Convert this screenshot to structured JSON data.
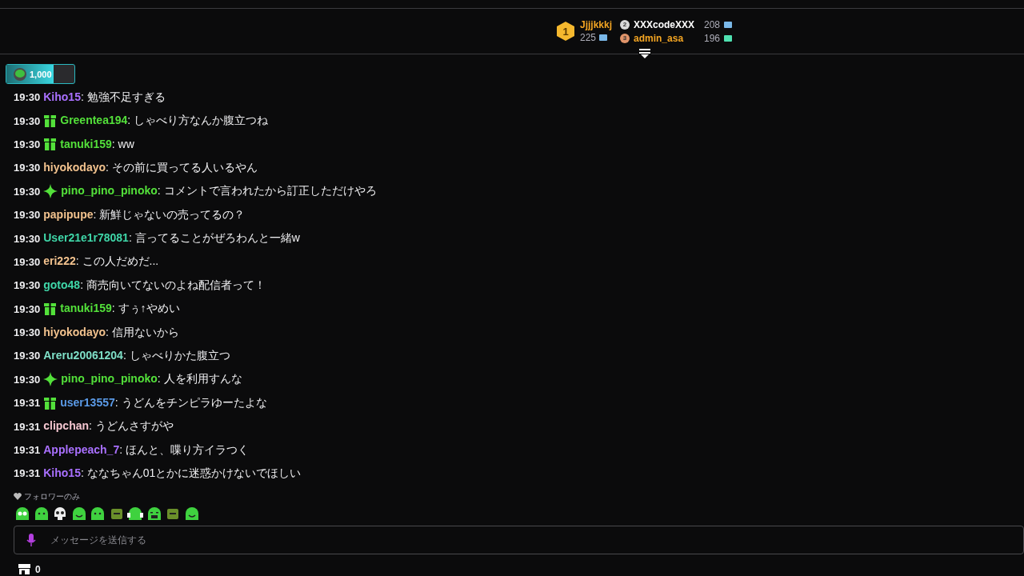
{
  "leaderboard": [
    {
      "rank": "1",
      "name": "Jjjjkkkj",
      "points": "225",
      "color": "#f5a623"
    },
    {
      "rank": "2",
      "name": "XXXcodeXXX",
      "points": "208",
      "color": "#ffffff"
    },
    {
      "rank": "3",
      "name": "admin_asa",
      "points": "196",
      "color": "#f5a623"
    }
  ],
  "goal": {
    "amount": "1,000",
    "level": 0.69
  },
  "messages": [
    {
      "time": "19:30",
      "kind": "plain",
      "user": "Kiho15",
      "color": "#a970ff",
      "text": ": 勉強不足すぎる"
    },
    {
      "time": "19:30",
      "kind": "gift",
      "user": "Greentea194",
      "color": "#53e03a",
      "text": ": しゃべり方なんか腹立つね"
    },
    {
      "time": "19:30",
      "kind": "gift",
      "user": "tanuki159",
      "color": "#53e03a",
      "text": ": ww"
    },
    {
      "time": "19:30",
      "kind": "plain",
      "user": "hiyokodayo",
      "color": "#f2c28e",
      "text": ": その前に買ってる人いるやん"
    },
    {
      "time": "19:30",
      "kind": "star",
      "user": "pino_pino_pinoko",
      "color": "#53e03a",
      "text": ": コメントで言われたから訂正しただけやろ"
    },
    {
      "time": "19:30",
      "kind": "plain",
      "user": "papipupe",
      "color": "#f2c28e",
      "text": ": 新鮮じゃないの売ってるの？"
    },
    {
      "time": "19:30",
      "kind": "plain",
      "user": "User21e1r78081",
      "color": "#3fd6a8",
      "text": ": 言ってることがぜろわんと一緒w"
    },
    {
      "time": "19:30",
      "kind": "plain",
      "user": "eri222",
      "color": "#f2c28e",
      "text": ": この人だめだ..."
    },
    {
      "time": "19:30",
      "kind": "plain",
      "user": "goto48",
      "color": "#3fd6a8",
      "text": ": 商売向いてないのよね配信者って！"
    },
    {
      "time": "19:30",
      "kind": "gift",
      "user": "tanuki159",
      "color": "#53e03a",
      "text": ": すぅ↑やめい"
    },
    {
      "time": "19:30",
      "kind": "plain",
      "user": "hiyokodayo",
      "color": "#f2c28e",
      "text": ": 信用ないから"
    },
    {
      "time": "19:30",
      "kind": "plain",
      "user": "Areru20061204",
      "color": "#7fe0c8",
      "text": ": しゃべりかた腹立つ"
    },
    {
      "time": "19:30",
      "kind": "star",
      "user": "pino_pino_pinoko",
      "color": "#53e03a",
      "text": ": 人を利用すんな"
    },
    {
      "time": "19:31",
      "kind": "gift",
      "user": "user13557",
      "color": "#5b9be8",
      "text": ": うどんをチンピラゆーたよな"
    },
    {
      "time": "19:31",
      "kind": "plain",
      "user": "clipchan",
      "color": "#f4c6d0",
      "text": ": うどんさすがや"
    },
    {
      "time": "19:31",
      "kind": "plain",
      "user": "Applepeach_7",
      "color": "#a970ff",
      "text": ": ほんと、喋り方イラつく"
    },
    {
      "time": "19:31",
      "kind": "plain",
      "user": "Kiho15",
      "color": "#a970ff",
      "text": ": ななちゃん01とかに迷惑かけないでほしい"
    }
  ],
  "chat_mode": "フォロワーのみ",
  "input": {
    "placeholder": "メッセージを送信する"
  },
  "store": {
    "count": "0"
  }
}
